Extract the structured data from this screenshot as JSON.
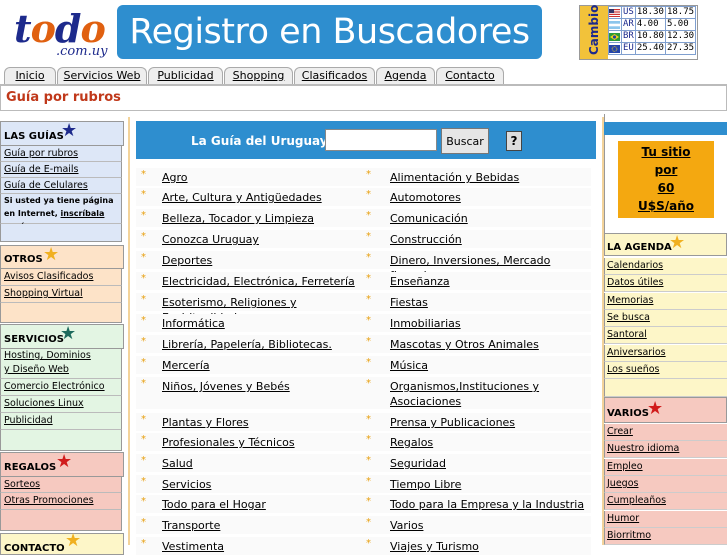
{
  "header": {
    "logo_text": "todo",
    "logo_sub": ".com.uy",
    "banner_title": "Registro en Buscadores",
    "cambio_label": "Cambio",
    "rates": [
      {
        "cur": "US",
        "buy": "18.30",
        "sell": "18.75"
      },
      {
        "cur": "AR",
        "buy": "4.00",
        "sell": "5.00"
      },
      {
        "cur": "BR",
        "buy": "10.80",
        "sell": "12.30"
      },
      {
        "cur": "EU",
        "buy": "25.40",
        "sell": "27.35"
      }
    ]
  },
  "tabs": [
    "Inicio",
    "Servicios Web",
    "Publicidad",
    "Shopping",
    "Clasificados",
    "Agenda",
    "Contacto"
  ],
  "breadcrumb": "Guía por rubros",
  "left": {
    "guias": {
      "title": "LAS GUÍAS",
      "items": [
        "Guía por rubros",
        "Guía de E-mails",
        "Guía de Celulares"
      ],
      "note_text": "Si usted ya tiene página en Internet, ",
      "note_link": "inscríbala aquí"
    },
    "otros": {
      "title": "OTROS",
      "items": [
        "Avisos Clasificados",
        "Shopping Virtual"
      ]
    },
    "servicios": {
      "title": "SERVICIOS",
      "items": [
        "Hosting, Dominios",
        "y Diseño Web",
        "Comercio Electrónico",
        "Soluciones Linux",
        "Publicidad"
      ]
    },
    "regalos": {
      "title": "REGALOS",
      "items": [
        "Sorteos",
        "Otras Promociones"
      ]
    },
    "contacto": {
      "title": "CONTACTO"
    }
  },
  "search": {
    "label": "La Guía del Uruguay",
    "value": "",
    "button": "Buscar",
    "help": "?"
  },
  "categories_left": [
    "Agro",
    "Arte, Cultura y Antigüedades",
    "Belleza, Tocador y Limpieza",
    "Conozca Uruguay",
    "Deportes",
    "Electricidad, Electrónica, Ferretería",
    "Esoterismo, Religiones y Espiritualidad",
    "Informática",
    "Librería, Papelería, Bibliotecas.",
    "Mercería",
    "Niños, Jóvenes y Bebés",
    "Plantas y Flores",
    "Profesionales y Técnicos",
    "Salud",
    "Servicios",
    "Todo para el Hogar",
    "Transporte",
    "Vestimenta"
  ],
  "categories_right": [
    "Alimentación y Bebidas",
    "Automotores",
    "Comunicación",
    "Construcción",
    "Dinero, Inversiones, Mercado financiero",
    "Enseñanza",
    "Fiestas",
    "Inmobiliarias",
    "Mascotas y Otros Animales",
    "Música",
    "Organismos,Instituciones y Asociaciones",
    "Prensa y Publicaciones",
    "Regalos",
    "Seguridad",
    "Tiempo Libre",
    "Todo para la Empresa y la Industria",
    "Varios",
    "Viajes y Turismo"
  ],
  "right": {
    "promo": [
      "Tu sitio",
      "por",
      "60",
      "U$S/año"
    ],
    "agenda": {
      "title": "LA AGENDA",
      "items": [
        "Calendarios",
        "Datos útiles",
        "Memorias",
        "Se busca",
        "Santoral",
        "Aniversarios",
        "Los sueños"
      ]
    },
    "varios": {
      "title": "VARIOS",
      "items": [
        "Crear",
        "Nuestro idioma",
        "Empleo",
        "Juegos",
        "Cumpleaños",
        "Humor",
        "Biorritmo"
      ]
    }
  },
  "colors": {
    "blue": "#2e8ecf",
    "navy": "#1d2a8c",
    "orange_text": "#c0381a",
    "guias_bg": "#dde7f7",
    "otros_bg": "#fde3c8",
    "servicios_bg": "#e3f5e3",
    "regalos_bg": "#f6c9c0",
    "agenda_bg": "#fdf6c8",
    "varios_bg": "#f6c9c0",
    "promo_bg": "#f4a810"
  }
}
